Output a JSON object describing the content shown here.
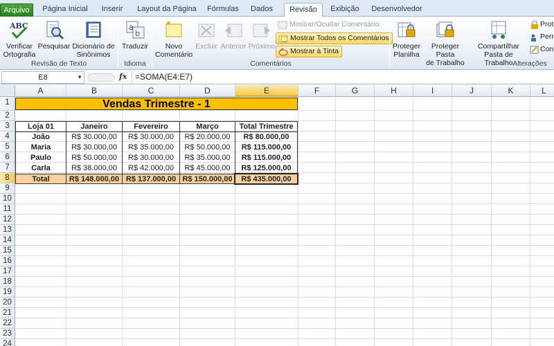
{
  "tabs": [
    {
      "label": "Arquivo"
    },
    {
      "label": "Página Inicial"
    },
    {
      "label": "Inserir"
    },
    {
      "label": "Layout da Página"
    },
    {
      "label": "Fórmulas"
    },
    {
      "label": "Dados"
    },
    {
      "label": "Revisão"
    },
    {
      "label": "Exibição"
    },
    {
      "label": "Desenvolvedor"
    }
  ],
  "ribbon": {
    "spell": {
      "line1": "Verificar",
      "line2": "Ortografia"
    },
    "research": {
      "line1": "Pesquisar"
    },
    "thesaurus": {
      "line1": "Dicionário de",
      "line2": "Sinônimos"
    },
    "group_proofing": "Revisão de Texto",
    "translate": {
      "line1": "Traduzir"
    },
    "group_language": "Idioma",
    "new_comment": {
      "line1": "Novo",
      "line2": "Comentário"
    },
    "delete": {
      "line1": "Excluir"
    },
    "previous": {
      "line1": "Anterior"
    },
    "next": {
      "line1": "Próximo"
    },
    "show_hide": "Mostrar/Ocultar Comentário",
    "show_all": "Mostrar Todos os Comentários",
    "show_ink": "Mostrar à Tinta",
    "group_comments": "Comentários",
    "protect_sheet": {
      "line1": "Proteger",
      "line2": "Planilha"
    },
    "protect_workbook": {
      "line1": "Proteger Pasta",
      "line2": "de Trabalho"
    },
    "share_workbook": {
      "line1": "Compartilhar",
      "line2": "Pasta de Trabalho"
    },
    "prot_partial": "Prot",
    "perm_partial": "Perm",
    "con_partial": "Con",
    "group_changes": "Alterações"
  },
  "formula_bar": {
    "name_box": "E8",
    "fx": "fx",
    "formula": "=SOMA(E4:E7)"
  },
  "columns": [
    "A",
    "B",
    "C",
    "D",
    "E",
    "F",
    "G",
    "H",
    "I",
    "J",
    "K",
    "L"
  ],
  "rows": [
    "1",
    "2",
    "3",
    "4",
    "5",
    "6",
    "7",
    "8",
    "9",
    "10",
    "11",
    "12",
    "13",
    "14",
    "15",
    "16",
    "17",
    "18",
    "19",
    "20",
    "21",
    "22",
    "23",
    "24"
  ],
  "sheet": {
    "title": "Vendas Trimestre - 1",
    "headers": [
      "Loja 01",
      "Janeiro",
      "Fevereiro",
      "Março",
      "Total Trimestre"
    ],
    "data": [
      [
        "João",
        "R$ 30.000,00",
        "R$ 30.000,00",
        "R$ 20.000,00",
        "R$ 80.000,00"
      ],
      [
        "Maria",
        "R$ 30.000,00",
        "R$ 35.000,00",
        "R$ 50.000,00",
        "R$ 115.000,00"
      ],
      [
        "Paulo",
        "R$ 50.000,00",
        "R$ 30.000,00",
        "R$ 35.000,00",
        "R$ 115.000,00"
      ],
      [
        "Carla",
        "R$ 38.000,00",
        "R$ 42.000,00",
        "R$ 45.000,00",
        "R$ 125.000,00"
      ]
    ],
    "total": [
      "Total",
      "R$ 148.000,00",
      "R$ 137.000,00",
      "R$ 150.000,00",
      "R$ 435.000,00"
    ]
  },
  "colors": {
    "title_fill": "#ffc000",
    "total_fill": "#fbcf9f",
    "file_tab": "#2a7d22"
  }
}
